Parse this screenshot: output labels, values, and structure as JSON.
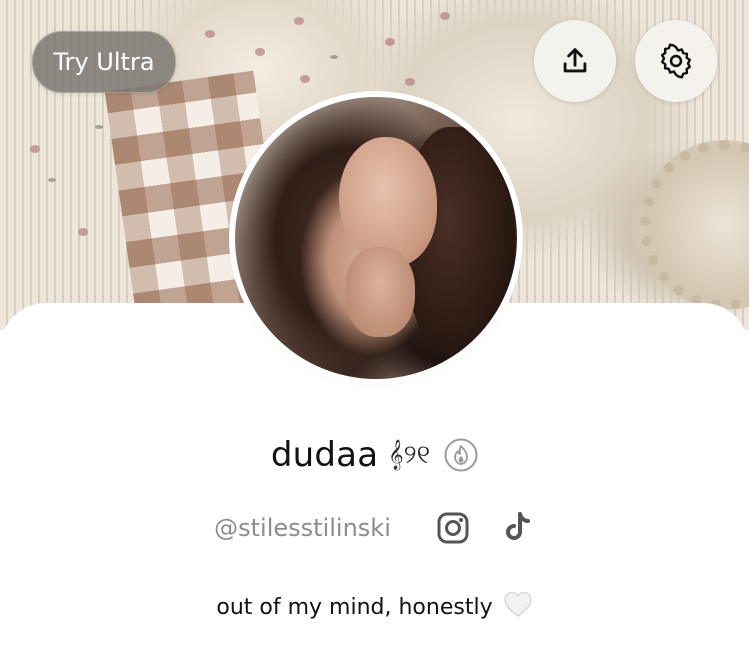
{
  "header": {
    "ultra_button_label": "Try Ultra",
    "share_icon": "upload-share-icon",
    "settings_icon": "gear-icon"
  },
  "profile": {
    "display_name": "dudaa",
    "name_emoji": "𝄞୨୧",
    "badge_icon": "flame-icon",
    "username": "@stilesstilinski",
    "social_icons": [
      "instagram-icon",
      "tiktok-icon"
    ],
    "bio_text": "out of my mind, honestly",
    "bio_emoji_icon": "white-heart-icon"
  },
  "colors": {
    "sheet": "#ffffff",
    "name_text": "#111111",
    "muted_text": "#8c8c8c",
    "pill_bg": "#7d7872",
    "circle_button_bg": "#f5f2ed",
    "badge": "#9a9a9a"
  }
}
